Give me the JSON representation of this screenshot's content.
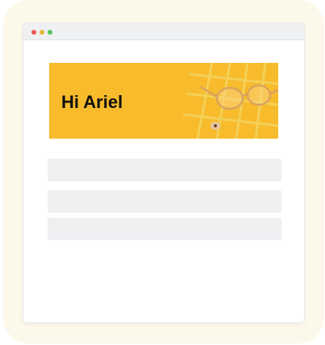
{
  "banner": {
    "greeting": "Hi Ariel",
    "background_color": "#f7bb2c",
    "decoration_icons": [
      "glasses-icon",
      "pencil-icon",
      "grid-rack-icon"
    ]
  },
  "window": {
    "controls": [
      "close-dot",
      "minimize-dot",
      "maximize-dot"
    ],
    "control_colors": [
      "#ea5a4f",
      "#e8b73a",
      "#58c25a"
    ]
  },
  "content": {
    "placeholder_rows": 3
  },
  "colors": {
    "frame": "#fcf8ea",
    "placeholder": "#eef0f2"
  }
}
